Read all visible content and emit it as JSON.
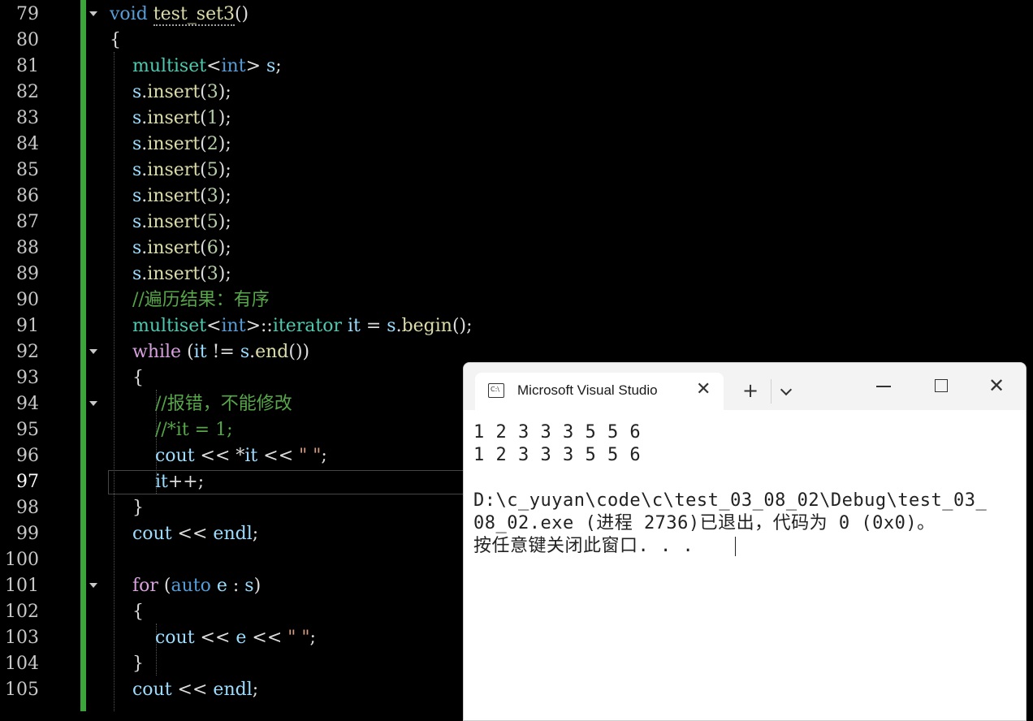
{
  "editor": {
    "lines": [
      {
        "num": "79",
        "tokens": [
          [
            "kw",
            "void "
          ],
          [
            "fn sq",
            "test_set3"
          ],
          [
            "pl",
            "()"
          ]
        ]
      },
      {
        "num": "80",
        "tokens": [
          [
            "pl",
            "{"
          ]
        ]
      },
      {
        "num": "81",
        "tokens": [
          [
            "pl",
            "    "
          ],
          [
            "ty",
            "multiset"
          ],
          [
            "pl",
            "<"
          ],
          [
            "kw",
            "int"
          ],
          [
            "pl",
            "> "
          ],
          [
            "var",
            "s"
          ],
          [
            "pl",
            ";"
          ]
        ]
      },
      {
        "num": "82",
        "tokens": [
          [
            "pl",
            "    "
          ],
          [
            "var",
            "s"
          ],
          [
            "pl",
            "."
          ],
          [
            "fn",
            "insert"
          ],
          [
            "pl",
            "("
          ],
          [
            "num",
            "3"
          ],
          [
            "pl",
            ");"
          ]
        ]
      },
      {
        "num": "83",
        "tokens": [
          [
            "pl",
            "    "
          ],
          [
            "var",
            "s"
          ],
          [
            "pl",
            "."
          ],
          [
            "fn",
            "insert"
          ],
          [
            "pl",
            "("
          ],
          [
            "num",
            "1"
          ],
          [
            "pl",
            ");"
          ]
        ]
      },
      {
        "num": "84",
        "tokens": [
          [
            "pl",
            "    "
          ],
          [
            "var",
            "s"
          ],
          [
            "pl",
            "."
          ],
          [
            "fn",
            "insert"
          ],
          [
            "pl",
            "("
          ],
          [
            "num",
            "2"
          ],
          [
            "pl",
            ");"
          ]
        ]
      },
      {
        "num": "85",
        "tokens": [
          [
            "pl",
            "    "
          ],
          [
            "var",
            "s"
          ],
          [
            "pl",
            "."
          ],
          [
            "fn",
            "insert"
          ],
          [
            "pl",
            "("
          ],
          [
            "num",
            "5"
          ],
          [
            "pl",
            ");"
          ]
        ]
      },
      {
        "num": "86",
        "tokens": [
          [
            "pl",
            "    "
          ],
          [
            "var",
            "s"
          ],
          [
            "pl",
            "."
          ],
          [
            "fn",
            "insert"
          ],
          [
            "pl",
            "("
          ],
          [
            "num",
            "3"
          ],
          [
            "pl",
            ");"
          ]
        ]
      },
      {
        "num": "87",
        "tokens": [
          [
            "pl",
            "    "
          ],
          [
            "var",
            "s"
          ],
          [
            "pl",
            "."
          ],
          [
            "fn",
            "insert"
          ],
          [
            "pl",
            "("
          ],
          [
            "num",
            "5"
          ],
          [
            "pl",
            ");"
          ]
        ]
      },
      {
        "num": "88",
        "tokens": [
          [
            "pl",
            "    "
          ],
          [
            "var",
            "s"
          ],
          [
            "pl",
            "."
          ],
          [
            "fn",
            "insert"
          ],
          [
            "pl",
            "("
          ],
          [
            "num",
            "6"
          ],
          [
            "pl",
            ");"
          ]
        ]
      },
      {
        "num": "89",
        "tokens": [
          [
            "pl",
            "    "
          ],
          [
            "var",
            "s"
          ],
          [
            "pl",
            "."
          ],
          [
            "fn",
            "insert"
          ],
          [
            "pl",
            "("
          ],
          [
            "num",
            "3"
          ],
          [
            "pl",
            ");"
          ]
        ]
      },
      {
        "num": "90",
        "tokens": [
          [
            "pl",
            "    "
          ],
          [
            "cm",
            "//遍历结果：有序"
          ]
        ]
      },
      {
        "num": "91",
        "tokens": [
          [
            "pl",
            "    "
          ],
          [
            "ty",
            "multiset"
          ],
          [
            "pl",
            "<"
          ],
          [
            "kw",
            "int"
          ],
          [
            "pl",
            ">::"
          ],
          [
            "ty",
            "iterator"
          ],
          [
            "pl",
            " "
          ],
          [
            "var",
            "it"
          ],
          [
            "pl",
            " = "
          ],
          [
            "var",
            "s"
          ],
          [
            "pl",
            "."
          ],
          [
            "fn",
            "begin"
          ],
          [
            "pl",
            "();"
          ]
        ]
      },
      {
        "num": "92",
        "tokens": [
          [
            "pl",
            "    "
          ],
          [
            "kwp",
            "while"
          ],
          [
            "pl",
            " ("
          ],
          [
            "var",
            "it"
          ],
          [
            "pl",
            " != "
          ],
          [
            "var",
            "s"
          ],
          [
            "pl",
            "."
          ],
          [
            "fn",
            "end"
          ],
          [
            "pl",
            "())"
          ]
        ]
      },
      {
        "num": "93",
        "tokens": [
          [
            "pl",
            "    {"
          ]
        ]
      },
      {
        "num": "94",
        "tokens": [
          [
            "pl",
            "        "
          ],
          [
            "cm",
            "//报错，不能修改"
          ]
        ]
      },
      {
        "num": "95",
        "tokens": [
          [
            "pl",
            "        "
          ],
          [
            "cm",
            "//*it = 1;"
          ]
        ]
      },
      {
        "num": "96",
        "tokens": [
          [
            "pl",
            "        "
          ],
          [
            "var",
            "cout"
          ],
          [
            "pl",
            " << *"
          ],
          [
            "var",
            "it"
          ],
          [
            "pl",
            " << "
          ],
          [
            "str",
            "\" \""
          ],
          [
            "pl",
            ";"
          ]
        ]
      },
      {
        "num": "97",
        "tokens": [
          [
            "pl",
            "        "
          ],
          [
            "var",
            "it"
          ],
          [
            "pl",
            "++;"
          ]
        ]
      },
      {
        "num": "98",
        "tokens": [
          [
            "pl",
            "    }"
          ]
        ]
      },
      {
        "num": "99",
        "tokens": [
          [
            "pl",
            "    "
          ],
          [
            "var",
            "cout"
          ],
          [
            "pl",
            " << "
          ],
          [
            "var",
            "endl"
          ],
          [
            "pl",
            ";"
          ]
        ]
      },
      {
        "num": "100",
        "tokens": []
      },
      {
        "num": "101",
        "tokens": [
          [
            "pl",
            "    "
          ],
          [
            "kwp",
            "for"
          ],
          [
            "pl",
            " ("
          ],
          [
            "kw",
            "auto"
          ],
          [
            "pl",
            " "
          ],
          [
            "var",
            "e"
          ],
          [
            "pl",
            " : "
          ],
          [
            "var",
            "s"
          ],
          [
            "pl",
            ")"
          ]
        ]
      },
      {
        "num": "102",
        "tokens": [
          [
            "pl",
            "    {"
          ]
        ]
      },
      {
        "num": "103",
        "tokens": [
          [
            "pl",
            "        "
          ],
          [
            "var",
            "cout"
          ],
          [
            "pl",
            " << "
          ],
          [
            "var",
            "e"
          ],
          [
            "pl",
            " << "
          ],
          [
            "str",
            "\" \""
          ],
          [
            "pl",
            ";"
          ]
        ]
      },
      {
        "num": "104",
        "tokens": [
          [
            "pl",
            "    }"
          ]
        ]
      },
      {
        "num": "105",
        "tokens": [
          [
            "pl",
            "    "
          ],
          [
            "var",
            "cout"
          ],
          [
            "pl",
            " << "
          ],
          [
            "var",
            "endl"
          ],
          [
            "pl",
            ";"
          ]
        ]
      }
    ],
    "current_line": "97",
    "fold_lines": [
      "79",
      "92",
      "94",
      "101"
    ]
  },
  "console": {
    "tab_title": "Microsoft Visual Studio",
    "tab_icon_glyph": "C:\\",
    "close_tab_glyph": "✕",
    "new_tab_glyph": "+",
    "close_window_glyph": "✕",
    "output": [
      "1 2 3 3 3 5 5 6",
      "1 2 3 3 3 5 5 6",
      "",
      "D:\\c_yuyan\\code\\c\\test_03_08_02\\Debug\\test_03_",
      "08_02.exe (进程 2736)已退出，代码为 0 (0x0)。",
      "按任意键关闭此窗口. . ."
    ]
  },
  "colors": {
    "background": "#000000",
    "keyword": "#569cd6",
    "control_keyword": "#d8a0df",
    "function": "#dcdcaa",
    "type": "#4ec9b0",
    "variable": "#9cdcfe",
    "number": "#b5cea8",
    "comment": "#57a64a",
    "string": "#d69d85",
    "change_bar": "#3ba43b"
  }
}
